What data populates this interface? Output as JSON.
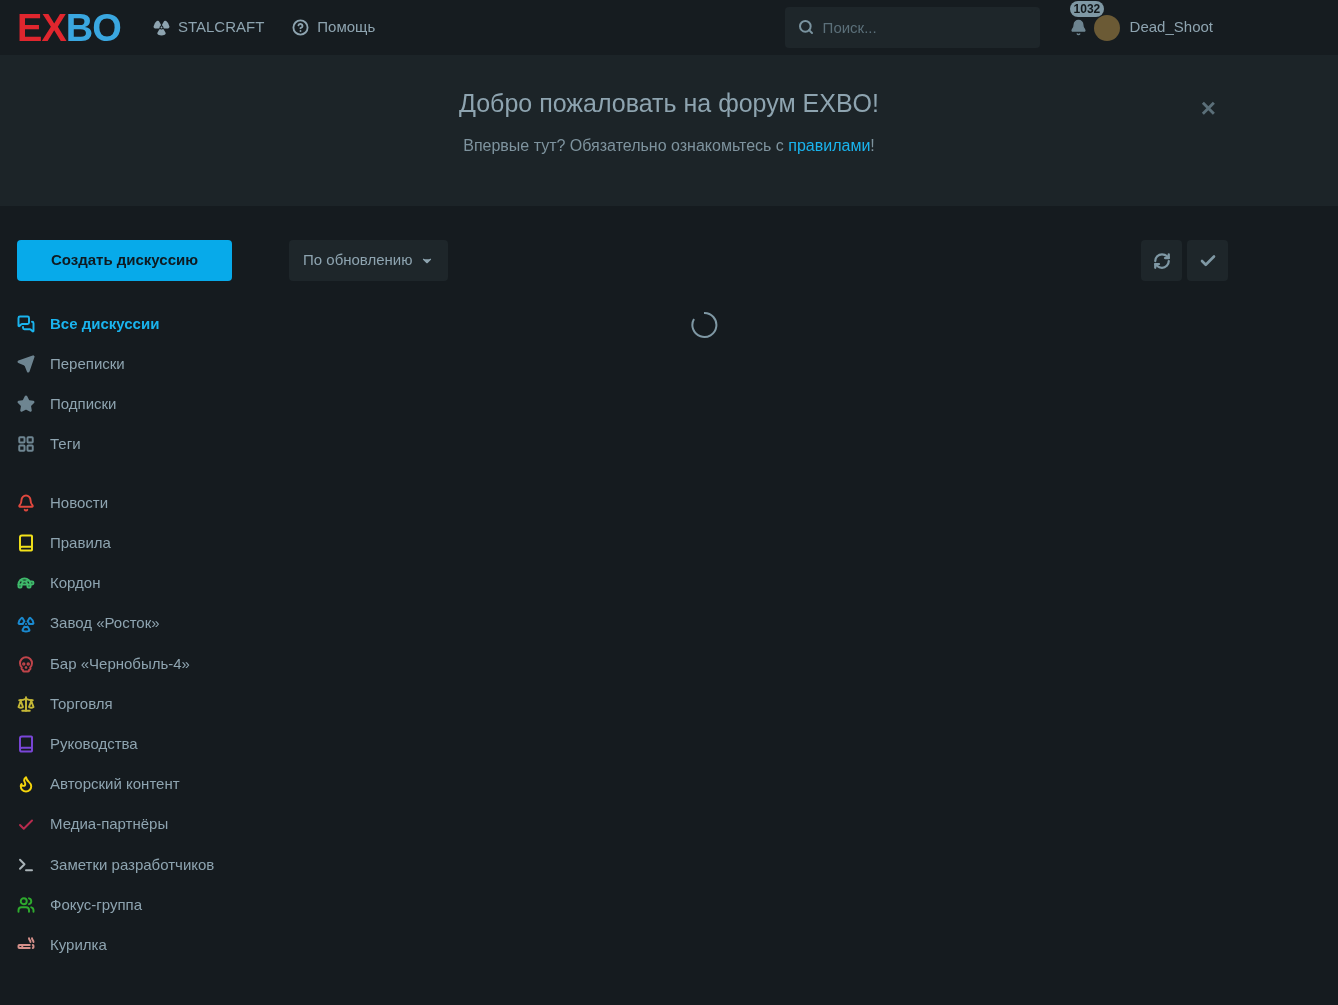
{
  "header": {
    "logo": "EXBO",
    "links": [
      {
        "kind": "radiation",
        "label": "STALCRAFT"
      },
      {
        "kind": "help",
        "label": "Помощь"
      }
    ],
    "search": {
      "placeholder": "Поиск..."
    },
    "notifications": {
      "count": "1032"
    },
    "user": {
      "name": "Dead_Shoot"
    }
  },
  "banner": {
    "title": "Добро пожаловать на форум EXBO!",
    "text": "Впервые тут? Обязательно ознакомьтесь с ",
    "link": "правилами",
    "after": "!",
    "close": "×"
  },
  "sidebar": {
    "create_button": "Создать дискуссию",
    "nav": [
      {
        "kind": "chats",
        "label": "Все дискуссии",
        "selected": true
      },
      {
        "kind": "send",
        "label": "Переписки",
        "selected": false
      },
      {
        "kind": "star",
        "label": "Подписки",
        "selected": false
      },
      {
        "kind": "grid",
        "label": "Теги",
        "selected": false
      }
    ],
    "tags": [
      {
        "kind": "bell",
        "label": "Новости",
        "color": "#e0483e"
      },
      {
        "kind": "book",
        "label": "Правила",
        "color": "#f2e21a"
      },
      {
        "kind": "frog",
        "label": "Кордон",
        "color": "#3fba6b"
      },
      {
        "kind": "radiation",
        "label": "Завод «Росток»",
        "color": "#1a8ad0"
      },
      {
        "kind": "skull",
        "label": "Бар «Чернобыль-4»",
        "color": "#c0444a"
      },
      {
        "kind": "scale",
        "label": "Торговля",
        "color": "#c5b836"
      },
      {
        "kind": "book",
        "label": "Руководства",
        "color": "#7a46d8"
      },
      {
        "kind": "flame",
        "label": "Авторский контент",
        "color": "#f5d50c"
      },
      {
        "kind": "check",
        "label": "Медиа-партнёры",
        "color": "#b82b4e"
      },
      {
        "kind": "terminal",
        "label": "Заметки разработчиков",
        "color": "#aab4b8"
      },
      {
        "kind": "users",
        "label": "Фокус-группа",
        "color": "#2eaa2e"
      },
      {
        "kind": "cigarette",
        "label": "Курилка",
        "color": "#d4908a"
      }
    ]
  },
  "toolbar": {
    "sort": "По обновлению"
  }
}
